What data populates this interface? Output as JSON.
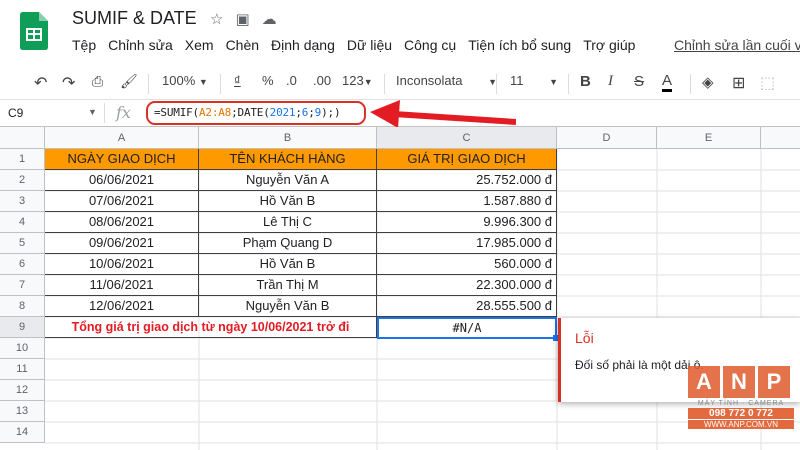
{
  "window": {
    "title": "SUMIF & DATE"
  },
  "menu": [
    "Tệp",
    "Chỉnh sửa",
    "Xem",
    "Chèn",
    "Định dạng",
    "Dữ liệu",
    "Công cụ",
    "Tiện ích bổ sung",
    "Trợ giúp"
  ],
  "last_edit": "Chỉnh sửa lần cuối vài",
  "toolbar": {
    "zoom": "100%",
    "currency": "₫",
    "percent": "%",
    "dec_less": ".0",
    "dec_more": ".00",
    "format_more": "123",
    "font": "Inconsolata",
    "font_size": "11",
    "bold": "B",
    "strike": "S",
    "text_color": "A"
  },
  "formula_bar": {
    "cell_ref": "C9",
    "fx": "fx",
    "formula_parts": [
      "=SUMIF(",
      "A2:A8",
      ";DATE(",
      "2021",
      ";",
      "6",
      ";",
      "9",
      ");)"
    ]
  },
  "columns": [
    "A",
    "B",
    "C",
    "D",
    "E"
  ],
  "rows": [
    "1",
    "2",
    "3",
    "4",
    "5",
    "6",
    "7",
    "8",
    "9",
    "10",
    "11",
    "12",
    "13",
    "14"
  ],
  "table": {
    "headers": [
      "NGÀY GIAO DỊCH",
      "TÊN KHÁCH HÀNG",
      "GIÁ TRỊ GIAO DỊCH"
    ],
    "data": [
      [
        "06/06/2021",
        "Nguyễn Văn A",
        "25.752.000 đ"
      ],
      [
        "07/06/2021",
        "Hồ Văn B",
        "1.587.880 đ"
      ],
      [
        "08/06/2021",
        "Lê Thị C",
        "9.996.300 đ"
      ],
      [
        "09/06/2021",
        "Phạm Quang D",
        "17.985.000 đ"
      ],
      [
        "10/06/2021",
        "Hồ Văn B",
        "560.000 đ"
      ],
      [
        "11/06/2021",
        "Trần Thị M",
        "22.300.000 đ"
      ],
      [
        "12/06/2021",
        "Nguyễn Văn B",
        "28.555.500 đ"
      ]
    ],
    "total_label": "Tổng giá trị giao dịch từ ngày 10/06/2021 trở đi",
    "total_value": "#N/A"
  },
  "error_tooltip": {
    "title": "Lỗi",
    "message": "Đối số phải là một dải ô."
  },
  "watermark": {
    "letters": [
      "A",
      "N",
      "P"
    ],
    "subtitle": "MÁY TÍNH · CAMERA",
    "phone": "098 772 0 772",
    "site": "WWW.ANP.COM.VN"
  },
  "colors": {
    "header_fill": "#ff9900",
    "total_label": "#e31b23",
    "error": "#d93025",
    "selection": "#1a73e8"
  }
}
